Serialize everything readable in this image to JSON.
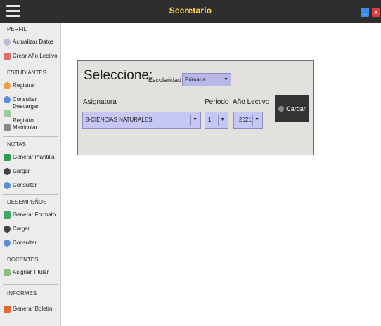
{
  "window": {
    "title": "Secretario",
    "minimize": "_",
    "close": "x"
  },
  "sidebar": {
    "perfil": {
      "header": "PERFIL",
      "items": [
        "Actualizar Datos",
        "Crear Año Lectivo"
      ]
    },
    "estudiantes": {
      "header": "ESTUDIANTES",
      "items": [
        "Registrar",
        "Consultar",
        "Descargar Registro",
        "Matricular"
      ]
    },
    "notas": {
      "header": "NOTAS",
      "items": [
        "Generar Plantilla",
        "Cargar",
        "Consultar"
      ]
    },
    "desempenos": {
      "header": "DESEMPEÑOS",
      "items": [
        "Generar Formato",
        "Cargar",
        "Consultar"
      ]
    },
    "docentes": {
      "header": "DOCENTES",
      "items": [
        "Asignar Titular"
      ]
    },
    "informes": {
      "header": "INFORMES",
      "items": [
        "Generar Boletín"
      ]
    }
  },
  "form": {
    "heading": "Seleccione:",
    "escolaridad_label": "Escolaridad",
    "escolaridad_value": "Primaria",
    "asignatura_label": "Asignatura",
    "asignatura_value": "8-CIENCIAS NATURALES",
    "periodo_label": "Periodo",
    "periodo_value": "1",
    "anio_label": "Año Lectivo",
    "anio_value": "2021",
    "cargar_label": "Cargar"
  },
  "colors": {
    "titlebar": "#2e2e2e",
    "title_text": "#ffd54a",
    "combo": "#c6c7f4",
    "button": "#333333"
  }
}
